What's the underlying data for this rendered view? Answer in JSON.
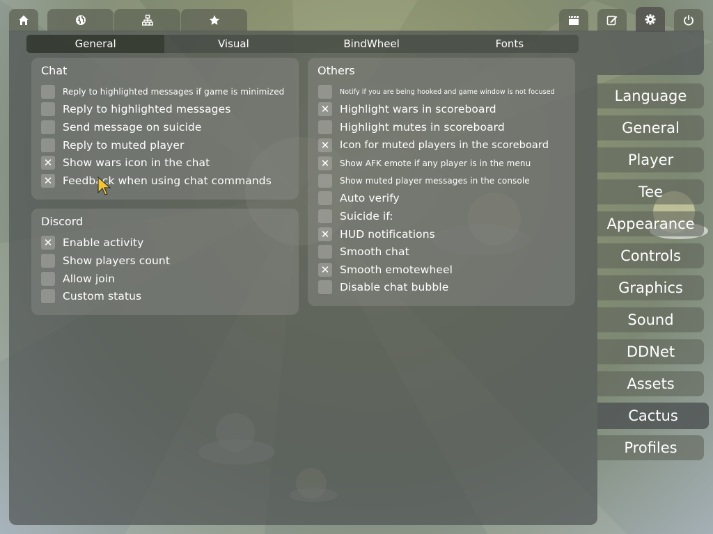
{
  "top_tabs_left": [
    {
      "name": "home",
      "icon": "home-icon"
    },
    {
      "name": "internet",
      "icon": "globe-icon"
    },
    {
      "name": "lan",
      "icon": "network-icon"
    },
    {
      "name": "favorites",
      "icon": "star-icon"
    }
  ],
  "top_tabs_right": [
    {
      "name": "demos",
      "icon": "clapperboard-icon"
    },
    {
      "name": "editor",
      "icon": "edit-icon"
    },
    {
      "name": "settings",
      "icon": "gear-icon"
    },
    {
      "name": "quit",
      "icon": "power-icon"
    }
  ],
  "subtabs": [
    "General",
    "Visual",
    "BindWheel",
    "Fonts"
  ],
  "chat": {
    "title": "Chat",
    "options": [
      {
        "label": "Reply to highlighted messages if game is minimized",
        "checked": false
      },
      {
        "label": "Reply to highlighted messages",
        "checked": false
      },
      {
        "label": "Send message on suicide",
        "checked": false
      },
      {
        "label": "Reply to muted player",
        "checked": false
      },
      {
        "label": "Show wars icon in the chat",
        "checked": true
      },
      {
        "label": "Feedback when using chat commands",
        "checked": true
      }
    ]
  },
  "discord": {
    "title": "Discord",
    "options": [
      {
        "label": "Enable activity",
        "checked": true
      },
      {
        "label": "Show players count",
        "checked": false
      },
      {
        "label": "Allow join",
        "checked": false
      },
      {
        "label": "Custom status",
        "checked": false
      }
    ]
  },
  "others": {
    "title": "Others",
    "options": [
      {
        "label": "Notify if you are being hooked and game window is not focused",
        "checked": false
      },
      {
        "label": "Highlight wars in scoreboard",
        "checked": true
      },
      {
        "label": "Highlight mutes in scoreboard",
        "checked": false
      },
      {
        "label": "Icon for muted players in the scoreboard",
        "checked": true
      },
      {
        "label": "Show AFK emote if any player is in the menu",
        "checked": true
      },
      {
        "label": "Show muted player messages in the console",
        "checked": false
      },
      {
        "label": "Auto verify",
        "checked": false
      },
      {
        "label": "Suicide if:",
        "checked": false
      },
      {
        "label": "HUD notifications",
        "checked": true
      },
      {
        "label": "Smooth chat",
        "checked": false
      },
      {
        "label": "Smooth emotewheel",
        "checked": true
      },
      {
        "label": "Disable chat bubble",
        "checked": false
      }
    ]
  },
  "settings_menu": [
    "Language",
    "General",
    "Player",
    "Tee",
    "Appearance",
    "Controls",
    "Graphics",
    "Sound",
    "DDNet",
    "Assets",
    "Cactus",
    "Profiles"
  ],
  "check_glyph": "✕"
}
